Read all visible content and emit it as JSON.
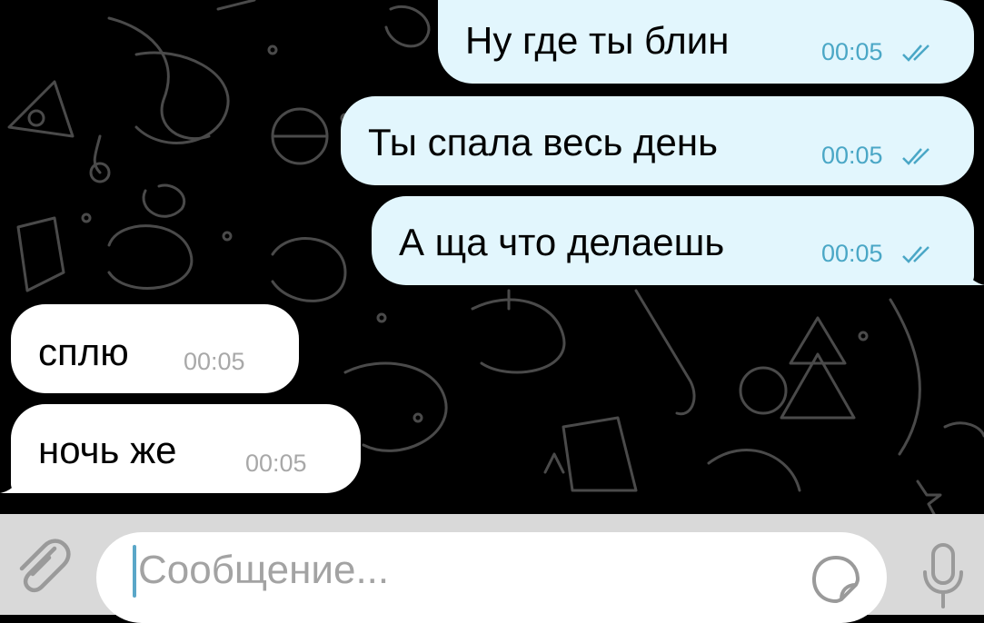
{
  "chat": {
    "messages": [
      {
        "direction": "outgoing",
        "text": "Ну где ты блин",
        "time": "00:05",
        "status": "double-check-read"
      },
      {
        "direction": "outgoing",
        "text": "Ты спала весь день",
        "time": "00:05",
        "status": "double-check-read"
      },
      {
        "direction": "outgoing",
        "text": "А ща что делаешь",
        "time": "00:05",
        "status": "double-check-read"
      },
      {
        "direction": "incoming",
        "text": "сплю",
        "time": "00:05"
      },
      {
        "direction": "incoming",
        "text": "ночь же",
        "time": "00:05"
      }
    ]
  },
  "composer": {
    "placeholder": "Сообщение...",
    "icons": [
      "paperclip-icon",
      "sticker-icon",
      "microphone-icon"
    ]
  },
  "colors": {
    "outgoing_bubble": "#e2f6fd",
    "incoming_bubble": "#ffffff",
    "chat_background": "#000000",
    "composer_background": "#d9d9d9",
    "time_outgoing": "#4aa7c6",
    "time_incoming": "#a8a8a8",
    "placeholder": "#a3a3a3"
  }
}
